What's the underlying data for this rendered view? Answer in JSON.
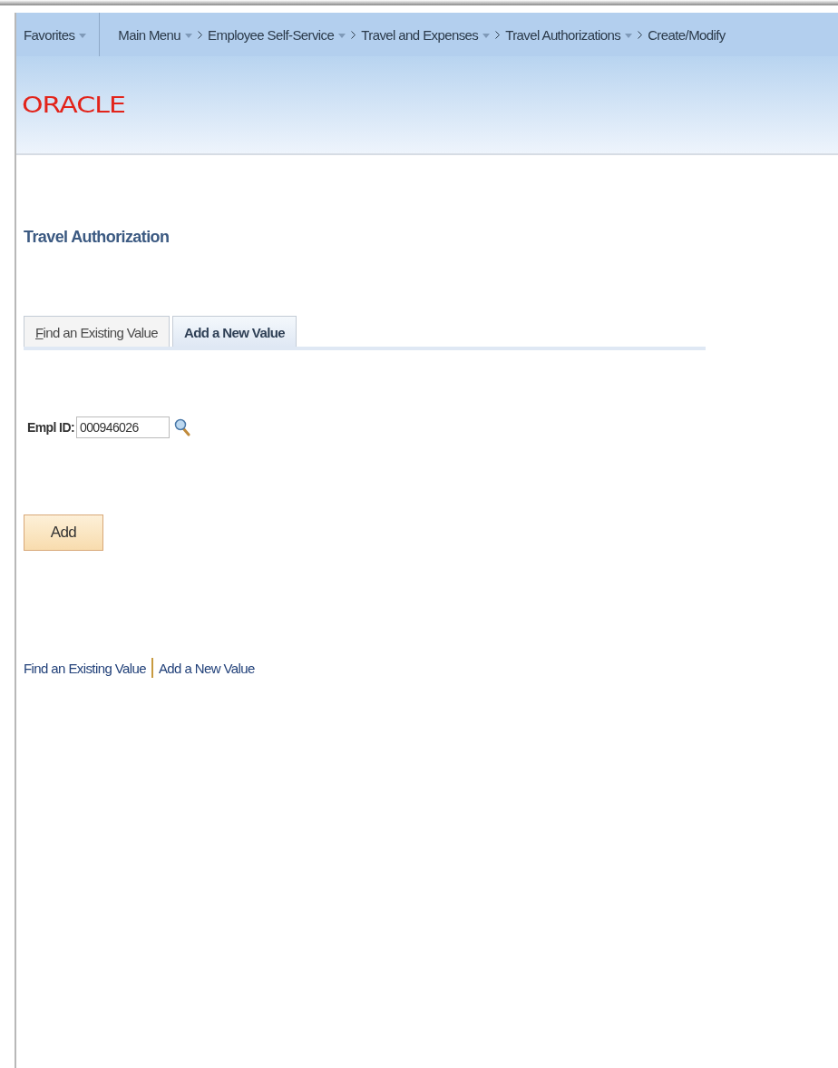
{
  "nav": {
    "favorites": {
      "label": "Favorites",
      "dropdown": true
    },
    "items": [
      {
        "label": "Main Menu",
        "chevron": false,
        "dropdown": true
      },
      {
        "label": "Employee Self-Service",
        "chevron": true,
        "dropdown": true
      },
      {
        "label": "Travel and Expenses",
        "chevron": true,
        "dropdown": true
      },
      {
        "label": "Travel Authorizations",
        "chevron": true,
        "dropdown": true
      },
      {
        "label": "Create/Modify",
        "chevron": true,
        "dropdown": false
      }
    ]
  },
  "logo": "ORACLE",
  "page_title": "Travel Authorization",
  "tabs": [
    {
      "label": "Find an Existing Value",
      "selected": false
    },
    {
      "label": "Add a New Value",
      "selected": true
    }
  ],
  "field": {
    "label": "Empl ID:",
    "value": "000946026"
  },
  "add_button": "Add",
  "bottom_links": [
    "Find an Existing Value",
    "Add a New Value"
  ]
}
